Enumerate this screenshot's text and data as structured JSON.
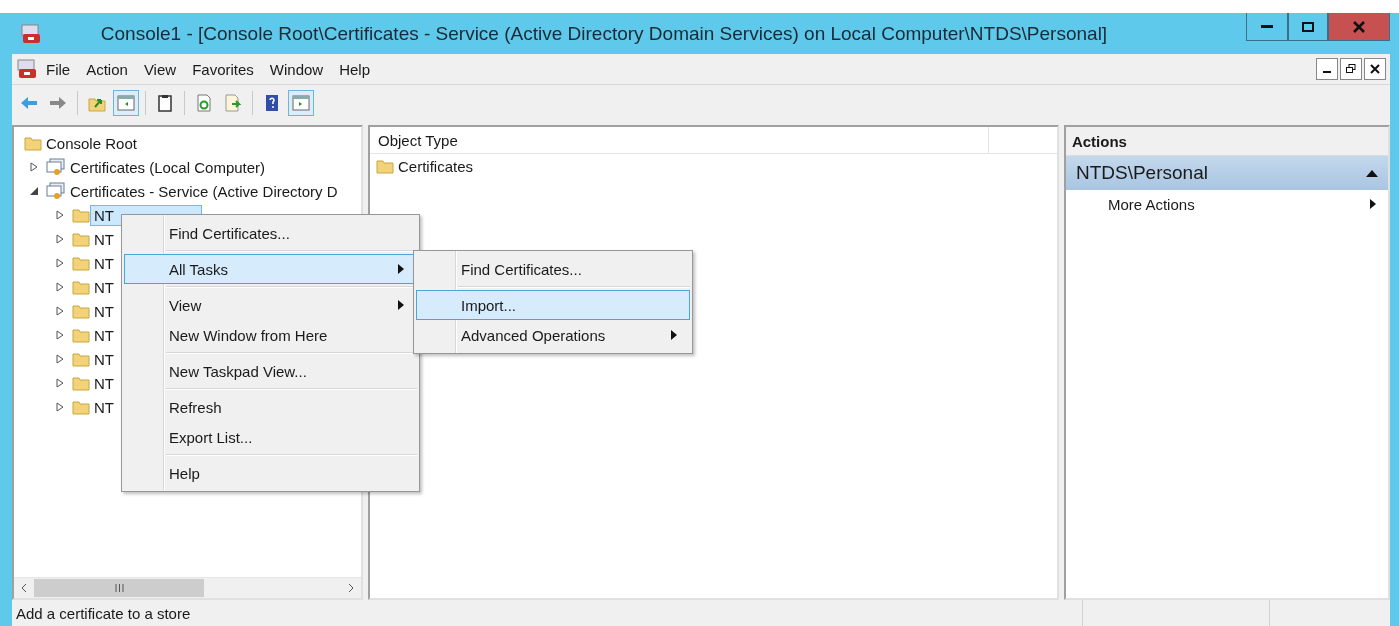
{
  "window": {
    "title": "Console1 - [Console Root\\Certificates - Service (Active Directory Domain Services) on Local Computer\\NTDS\\Personal]"
  },
  "menu_bar": [
    "File",
    "Action",
    "View",
    "Favorites",
    "Window",
    "Help"
  ],
  "toolbar": [
    {
      "kind": "back",
      "pressed": false
    },
    {
      "kind": "forward",
      "pressed": false
    },
    {
      "kind": "sep"
    },
    {
      "kind": "up",
      "pressed": false
    },
    {
      "kind": "tree",
      "pressed": true
    },
    {
      "kind": "sep"
    },
    {
      "kind": "clipboard",
      "pressed": false
    },
    {
      "kind": "sep"
    },
    {
      "kind": "refresh",
      "pressed": false
    },
    {
      "kind": "export",
      "pressed": false
    },
    {
      "kind": "sep"
    },
    {
      "kind": "help",
      "pressed": false
    },
    {
      "kind": "actionpane",
      "pressed": true
    }
  ],
  "tree": {
    "label": "Console Root",
    "kind": "folder",
    "expanded": true,
    "selected": false,
    "children": [
      {
        "label": "Certificates (Local Computer)",
        "kind": "snapin",
        "expanded": false,
        "selected": false
      },
      {
        "label": "Certificates - Service (Active Directory D",
        "kind": "snapin",
        "expanded": true,
        "selected": false,
        "children": [
          {
            "label": "NT",
            "kind": "folder",
            "expanded": false,
            "selected": true
          },
          {
            "label": "NT",
            "kind": "folder",
            "expanded": false,
            "selected": false
          },
          {
            "label": "NT",
            "kind": "folder",
            "expanded": false,
            "selected": false
          },
          {
            "label": "NT",
            "kind": "folder",
            "expanded": false,
            "selected": false
          },
          {
            "label": "NT",
            "kind": "folder",
            "expanded": false,
            "selected": false
          },
          {
            "label": "NT",
            "kind": "folder",
            "expanded": false,
            "selected": false
          },
          {
            "label": "NT",
            "kind": "folder",
            "expanded": false,
            "selected": false
          },
          {
            "label": "NT",
            "kind": "folder",
            "expanded": false,
            "selected": false
          },
          {
            "label": "NT",
            "kind": "folder",
            "expanded": false,
            "selected": false
          }
        ]
      }
    ]
  },
  "list": {
    "columns": [
      "Object Type"
    ],
    "rows": [
      "Certificates"
    ]
  },
  "actions": {
    "title": "Actions",
    "section": "NTDS\\Personal",
    "expanded": true,
    "items": [
      {
        "label": "More Actions",
        "submenu": true
      }
    ]
  },
  "context_menu": [
    {
      "label": "Find Certificates...",
      "separator_before": false,
      "submenu": false,
      "selected": false
    },
    {
      "label": "All Tasks",
      "separator_before": true,
      "submenu": true,
      "selected": true
    },
    {
      "label": "View",
      "separator_before": true,
      "submenu": true,
      "selected": false
    },
    {
      "label": "New Window from Here",
      "separator_before": false,
      "submenu": false,
      "selected": false
    },
    {
      "label": "New Taskpad View...",
      "separator_before": true,
      "submenu": false,
      "selected": false
    },
    {
      "label": "Refresh",
      "separator_before": true,
      "submenu": false,
      "selected": false
    },
    {
      "label": "Export List...",
      "separator_before": false,
      "submenu": false,
      "selected": false
    },
    {
      "label": "Help",
      "separator_before": true,
      "submenu": false,
      "selected": false
    }
  ],
  "submenu": [
    {
      "label": "Find Certificates...",
      "separator_before": false,
      "submenu": false,
      "selected": false
    },
    {
      "label": "Import...",
      "separator_before": true,
      "submenu": false,
      "selected": true
    },
    {
      "label": "Advanced Operations",
      "separator_before": false,
      "submenu": true,
      "selected": false
    }
  ],
  "status_bar": {
    "text": "Add a certificate to a store"
  }
}
